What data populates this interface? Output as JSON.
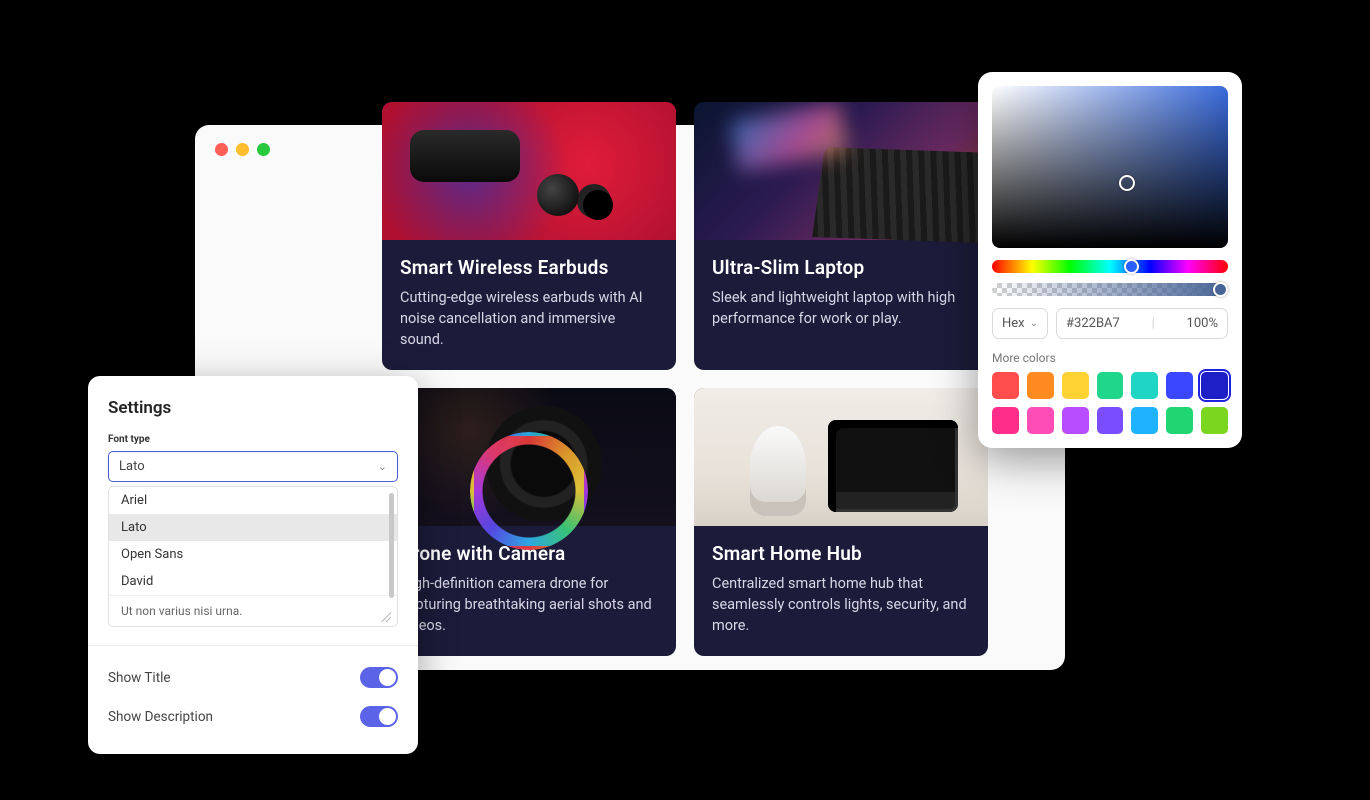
{
  "cards": [
    {
      "title": "Smart Wireless Earbuds",
      "desc": "Cutting-edge wireless earbuds with AI noise cancellation and immersive sound."
    },
    {
      "title": "Ultra-Slim Laptop",
      "desc": "Sleek and lightweight laptop with high performance for work or play."
    },
    {
      "title": "Drone with Camera",
      "desc": "High-definition camera drone for capturing breathtaking aerial shots and videos."
    },
    {
      "title": "Smart Home Hub",
      "desc": "Centralized smart home hub that seamlessly controls lights, security, and more."
    }
  ],
  "settings": {
    "title": "Settings",
    "font_label": "Font type",
    "font_value": "Lato",
    "font_options": [
      "Ariel",
      "Lato",
      "Open Sans",
      "David"
    ],
    "hint_text": "Ut non varius nisi urna.",
    "toggles": {
      "show_title_label": "Show Title",
      "show_title_on": true,
      "show_desc_label": "Show Description",
      "show_desc_on": true
    }
  },
  "color_picker": {
    "format_label": "Hex",
    "hex_value": "#322BA7",
    "opacity_value": "100%",
    "more_label": "More colors",
    "swatches_row1": [
      "#ff4d4d",
      "#ff8a1f",
      "#ffd233",
      "#1fd68a",
      "#1fd6c4",
      "#3a46ff",
      "#1f1fc7"
    ],
    "swatches_row2": [
      "#ff2e8a",
      "#ff4db8",
      "#b84dff",
      "#7a4dff",
      "#1fb2ff",
      "#1fd673",
      "#7ad61f"
    ],
    "selected_swatch_index": 6
  }
}
